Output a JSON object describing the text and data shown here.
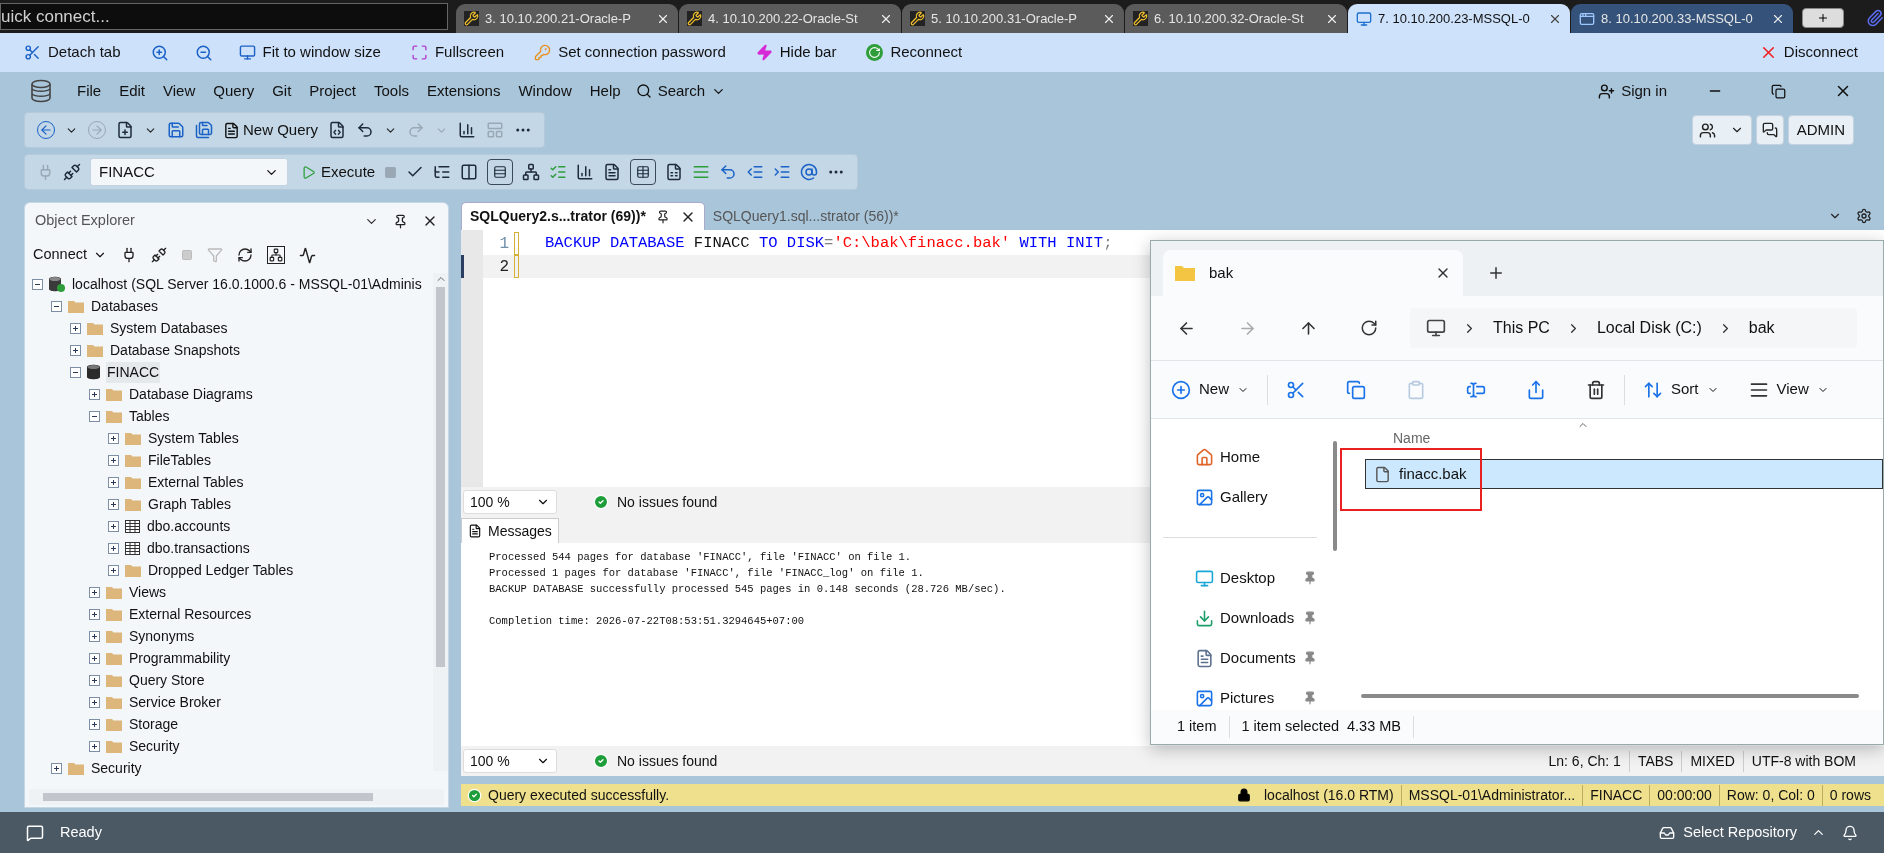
{
  "connection_bar": {
    "quick_connect": {
      "placeholder": "uick connect..."
    },
    "tabs": [
      {
        "label": "3. 10.10.200.21-Oracle-P",
        "kind": "terminal",
        "color": "#5b5b5b",
        "selected": false
      },
      {
        "label": "4. 10.10.200.22-Oracle-St",
        "kind": "terminal",
        "color": "#5b5b5b",
        "selected": false
      },
      {
        "label": "5. 10.10.200.31-Oracle-P",
        "kind": "terminal",
        "color": "#5b5b5b",
        "selected": false
      },
      {
        "label": "6. 10.10.200.32-Oracle-St",
        "kind": "terminal",
        "color": "#5b5b5b",
        "selected": false
      },
      {
        "label": "7. 10.10.200.23-MSSQL-0",
        "kind": "desktop",
        "color": "#cfe2fb",
        "selected": true
      },
      {
        "label": "8. 10.10.200.33-MSSQL-0",
        "kind": "windows",
        "color": "#34527a",
        "selected": false
      }
    ]
  },
  "session_toolbar": {
    "items": [
      "Detach tab",
      "Fit to window size",
      "Fullscreen",
      "Set connection password",
      "Hide bar",
      "Reconnect"
    ],
    "disconnect": "Disconnect"
  },
  "menu": {
    "items": [
      "File",
      "Edit",
      "View",
      "Query",
      "Git",
      "Project",
      "Tools",
      "Extensions",
      "Window",
      "Help"
    ],
    "search": "Search",
    "sign_in": "Sign in"
  },
  "toolbar": {
    "new_query": "New Query",
    "account": "ADMIN",
    "database": "FINACC",
    "execute": "Execute"
  },
  "object_explorer": {
    "title": "Object Explorer",
    "connect": "Connect",
    "tree": [
      {
        "label": "localhost (SQL Server 16.0.1000.6 - MSSQL-01\\Adminis",
        "kind": "server",
        "expanded": true,
        "selected": false,
        "children": [
          {
            "label": "Databases",
            "kind": "folder",
            "expanded": true,
            "selected": false,
            "children": [
              {
                "label": "System Databases",
                "kind": "folder",
                "expanded": false,
                "selected": false
              },
              {
                "label": "Database Snapshots",
                "kind": "folder",
                "expanded": false,
                "selected": false
              },
              {
                "label": "FINACC",
                "kind": "database",
                "expanded": true,
                "selected": true,
                "children": [
                  {
                    "label": "Database Diagrams",
                    "kind": "folder",
                    "expanded": false,
                    "selected": false
                  },
                  {
                    "label": "Tables",
                    "kind": "folder",
                    "expanded": true,
                    "selected": false,
                    "children": [
                      {
                        "label": "System Tables",
                        "kind": "folder",
                        "expanded": false,
                        "selected": false
                      },
                      {
                        "label": "FileTables",
                        "kind": "folder",
                        "expanded": false,
                        "selected": false
                      },
                      {
                        "label": "External Tables",
                        "kind": "folder",
                        "expanded": false,
                        "selected": false
                      },
                      {
                        "label": "Graph Tables",
                        "kind": "folder",
                        "expanded": false,
                        "selected": false
                      },
                      {
                        "label": "dbo.accounts",
                        "kind": "table",
                        "expanded": false,
                        "selected": false
                      },
                      {
                        "label": "dbo.transactions",
                        "kind": "table",
                        "expanded": false,
                        "selected": false
                      },
                      {
                        "label": "Dropped Ledger Tables",
                        "kind": "folder",
                        "expanded": false,
                        "selected": false
                      }
                    ]
                  },
                  {
                    "label": "Views",
                    "kind": "folder",
                    "expanded": false,
                    "selected": false
                  },
                  {
                    "label": "External Resources",
                    "kind": "folder",
                    "expanded": false,
                    "selected": false
                  },
                  {
                    "label": "Synonyms",
                    "kind": "folder",
                    "expanded": false,
                    "selected": false
                  },
                  {
                    "label": "Programmability",
                    "kind": "folder",
                    "expanded": false,
                    "selected": false
                  },
                  {
                    "label": "Query Store",
                    "kind": "folder",
                    "expanded": false,
                    "selected": false
                  },
                  {
                    "label": "Service Broker",
                    "kind": "folder",
                    "expanded": false,
                    "selected": false
                  },
                  {
                    "label": "Storage",
                    "kind": "folder",
                    "expanded": false,
                    "selected": false
                  },
                  {
                    "label": "Security",
                    "kind": "folder",
                    "expanded": false,
                    "selected": false
                  }
                ]
              }
            ]
          },
          {
            "label": "Security",
            "kind": "folder",
            "expanded": false,
            "selected": false
          }
        ]
      }
    ]
  },
  "editor": {
    "tabs": [
      {
        "label": "SQLQuery2.s...trator (69))*",
        "selected": true
      },
      {
        "label": "SQLQuery1.sql...strator (56))*",
        "selected": false
      }
    ],
    "lines": [
      {
        "number": "1",
        "changed": true,
        "current": false,
        "tokens": [
          {
            "text": "BACKUP DATABASE",
            "kind": "keyword"
          },
          {
            "text": " FINACC ",
            "kind": "plain"
          },
          {
            "text": "TO DISK",
            "kind": "keyword"
          },
          {
            "text": "=",
            "kind": "punct"
          },
          {
            "text": "'C:\\bak\\finacc.bak'",
            "kind": "string"
          },
          {
            "text": " WITH INIT",
            "kind": "keyword"
          },
          {
            "text": ";",
            "kind": "punct"
          }
        ]
      },
      {
        "number": "2",
        "changed": true,
        "current": true
      }
    ],
    "zoom": "100 %",
    "issues": "No issues found",
    "results_tab": "Messages",
    "messages": [
      [
        "Processed 544 pages for database 'FINACC', file 'FINACC' on file 1.",
        "Processed 1 pages for database 'FINACC', file 'FINACC_log' on file 1.",
        "BACKUP DATABASE successfully processed 545 pages in 0.148 seconds (28.726 MB/sec)."
      ],
      [
        "Completion time: 2026-07-22T08:53:51.3294645+07:00"
      ]
    ],
    "bottom_zoom": "100 %",
    "bottom_issues": "No issues found",
    "cursor": [
      "Ln: 6, Ch: 1",
      "TABS",
      "MIXED",
      "UTF-8 with BOM"
    ],
    "status": {
      "message": "Query executed successfully.",
      "fields": [
        "localhost (16.0 RTM)",
        "MSSQL-01\\Administrator...",
        "FINACC",
        "00:00:00",
        "Row: 0, Col: 0",
        "0 rows"
      ]
    }
  },
  "status_bar": {
    "text": "Ready",
    "repository": "Select Repository"
  },
  "file_explorer": {
    "tab": "bak",
    "breadcrumb": [
      "This PC",
      "Local Disk (C:)",
      "bak"
    ],
    "new": "New",
    "sort": "Sort",
    "view": "View",
    "nav_groups": [
      [
        {
          "label": "Home",
          "kind": "home",
          "pinned": false
        },
        {
          "label": "Gallery",
          "kind": "gallery",
          "pinned": false
        }
      ],
      [
        {
          "label": "Desktop",
          "kind": "desktop",
          "pinned": true
        },
        {
          "label": "Downloads",
          "kind": "downloads",
          "pinned": true
        },
        {
          "label": "Documents",
          "kind": "documents",
          "pinned": true
        },
        {
          "label": "Pictures",
          "kind": "pictures",
          "pinned": true
        }
      ]
    ],
    "column": "Name",
    "files": [
      {
        "name": "finacc.bak",
        "selected": true
      }
    ],
    "status": {
      "count": "1 item",
      "selection": "1 item selected",
      "size": "4.33 MB"
    }
  }
}
